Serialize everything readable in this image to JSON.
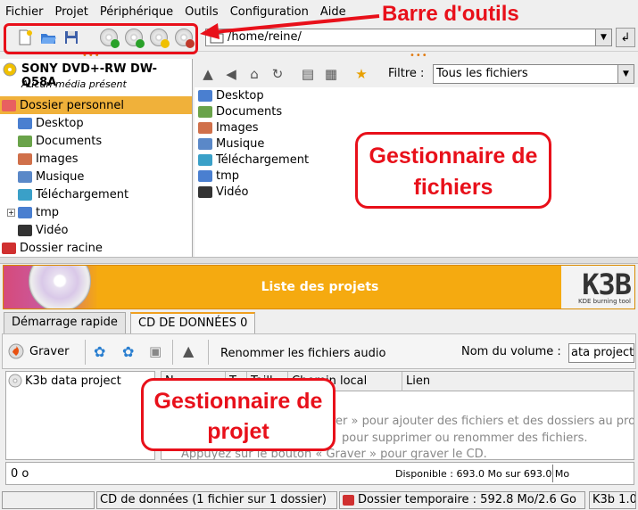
{
  "menubar": {
    "items": [
      "Fichier",
      "Projet",
      "Périphérique",
      "Outils",
      "Configuration",
      "Aide"
    ]
  },
  "path_bar": {
    "value": "/home/reine/"
  },
  "device": {
    "name": "SONY DVD+-RW DW-Q58A",
    "status": "Aucun média présent"
  },
  "tree": {
    "items": [
      {
        "label": "Dossier personnel",
        "selected": true
      },
      {
        "label": "Desktop"
      },
      {
        "label": "Documents"
      },
      {
        "label": "Images"
      },
      {
        "label": "Musique"
      },
      {
        "label": "Téléchargement"
      },
      {
        "label": "tmp",
        "expandable": "+"
      },
      {
        "label": "Vidéo"
      },
      {
        "label": "Dossier racine"
      }
    ]
  },
  "filter": {
    "label": "Filtre :",
    "value": "Tous les fichiers"
  },
  "files": [
    "Desktop",
    "Documents",
    "Images",
    "Musique",
    "Téléchargement",
    "tmp",
    "Vidéo"
  ],
  "banner": {
    "title": "Liste des projets",
    "logo": "K3B",
    "logo_sub": "KDE burning tool"
  },
  "tabs": [
    {
      "label": "Démarrage rapide"
    },
    {
      "label": "CD DE DONNÉES 0",
      "active": true
    }
  ],
  "project_toolbar": {
    "burn_label": "Graver",
    "rename_audio_label": "Renommer les fichiers audio",
    "volume_label": "Nom du volume :",
    "volume_value": "ata project"
  },
  "project_tree": {
    "root": "K3b data project"
  },
  "project_list": {
    "columns": [
      "N",
      "T",
      "Taill",
      "Chemin local",
      "Lien"
    ],
    "hints": [
      "rer » pour ajouter des fichiers et des dossiers au pro",
      "pour supprimer ou renommer des fichiers.",
      "Appuyez sur le bouton « Graver » pour graver le CD."
    ]
  },
  "size_bar": {
    "used": "0 o",
    "available": "Disponible : 693.0 Mo sur 693.0 Mo"
  },
  "status_bar": {
    "project": "CD de données (1 fichier sur 1 dossier)",
    "temp": "Dossier temporaire : 592.8 Mo/2.6 Go",
    "version": "K3b 1.0"
  },
  "annotations": {
    "toolbar": "Barre d'outils",
    "file_manager": "Gestionnaire de fichiers",
    "project_manager": "Gestionnaire de projet"
  },
  "colors": {
    "accent": "#f5aa10",
    "annotation": "#e8101a",
    "selection": "#f0b13a"
  }
}
